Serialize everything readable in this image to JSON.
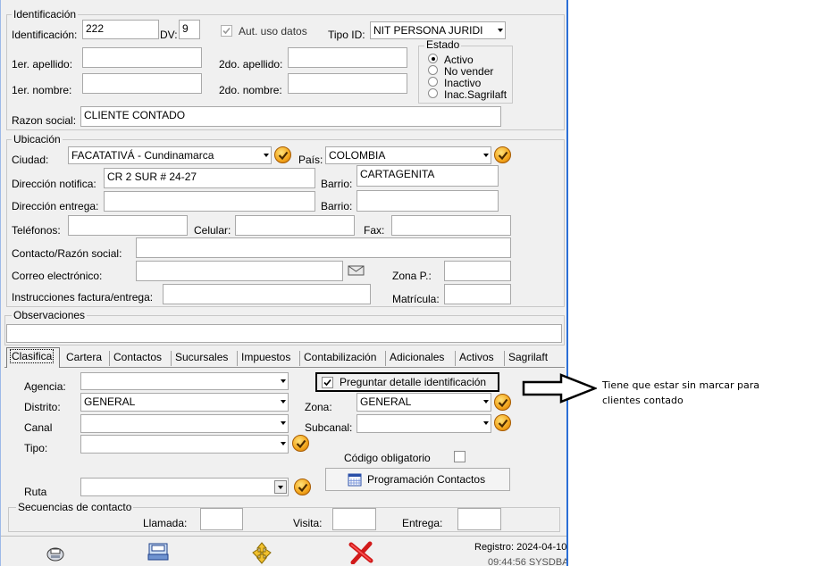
{
  "identificacion": {
    "group_title": "Identificación",
    "id_label": "Identificación:",
    "id_value": "222",
    "dv_label": "DV:",
    "dv_value": "9",
    "aut_label": "Aut. uso datos",
    "tipo_id_label": "Tipo ID:",
    "tipo_id_value": "NIT PERSONA JURIDI",
    "apellido1_label": "1er. apellido:",
    "apellido2_label": "2do. apellido:",
    "nombre1_label": "1er. nombre:",
    "nombre2_label": "2do. nombre:",
    "razon_label": "Razon social:",
    "razon_value": "CLIENTE CONTADO"
  },
  "estado": {
    "title": "Estado",
    "options": [
      "Activo",
      "No vender",
      "Inactivo",
      "Inac.Sagrilaft"
    ],
    "selected": "Activo"
  },
  "ubicacion": {
    "group_title": "Ubicación",
    "ciudad_label": "Ciudad:",
    "ciudad_value": "FACATATIVÁ - Cundinamarca",
    "pais_label": "País:",
    "pais_value": "COLOMBIA",
    "dir_notif_label": "Dirección notifica:",
    "dir_notif_value": "CR 2 SUR # 24-27",
    "barrio_label": "Barrio:",
    "barrio_value": "CARTAGENITA",
    "dir_entrega_label": "Dirección entrega:",
    "barrio2_label": "Barrio:",
    "telefonos_label": "Teléfonos:",
    "celular_label": "Celular:",
    "fax_label": "Fax:",
    "contacto_label": "Contacto/Razón social:",
    "correo_label": "Correo electrónico:",
    "zona_p_label": "Zona P.:",
    "instrucciones_label": "Instrucciones factura/entrega:",
    "matricula_label": "Matrícula:"
  },
  "observaciones": {
    "group_title": "Observaciones"
  },
  "tabs": [
    "Clasifica",
    "Cartera",
    "Contactos",
    "Sucursales",
    "Impuestos",
    "Contabilización",
    "Adicionales",
    "Activos",
    "Sagrilaft"
  ],
  "clasifica": {
    "agencia_label": "Agencia:",
    "preguntar_label": "Preguntar detalle identificación",
    "distrito_label": "Distrito:",
    "distrito_value": "GENERAL",
    "zona_label": "Zona:",
    "zona_value": "GENERAL",
    "canal_label": "Canal",
    "subcanal_label": "Subcanal:",
    "tipo_label": "Tipo:",
    "codigo_label": "Código obligatorio",
    "ruta_label": "Ruta",
    "programacion_label": "Programación Contactos"
  },
  "secuencias": {
    "group_title": "Secuencias de contacto",
    "llamada_label": "Llamada:",
    "visita_label": "Visita:",
    "entrega_label": "Entrega:"
  },
  "footer": {
    "registro_label": "Registro: 2024-04-10",
    "registro_sub": "09:44:56 SYSDBA"
  },
  "annotation": {
    "text_line1": "Tiene que estar sin marcar para",
    "text_line2": "clientes contado"
  },
  "colors": {
    "window_bg": "#f0f0f0",
    "accent_border": "#2b6fd6",
    "highlight_box": "#000000"
  }
}
